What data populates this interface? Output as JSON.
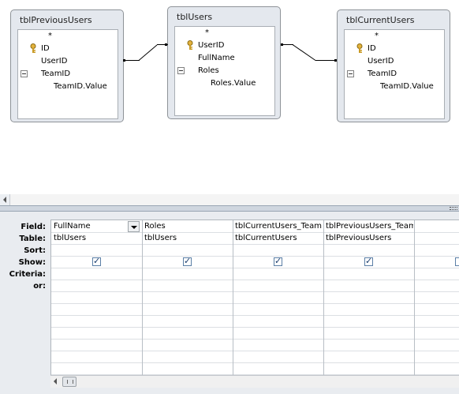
{
  "tables": [
    {
      "id": "prev",
      "title": "tblPreviousUsers",
      "rows": [
        {
          "text": "*",
          "kind": "star"
        },
        {
          "text": "ID",
          "kind": "key"
        },
        {
          "text": "UserID",
          "kind": "field"
        },
        {
          "text": "TeamID",
          "kind": "expand"
        },
        {
          "text": "TeamID.Value",
          "kind": "child"
        }
      ]
    },
    {
      "id": "users",
      "title": "tblUsers",
      "rows": [
        {
          "text": "*",
          "kind": "star"
        },
        {
          "text": "UserID",
          "kind": "key"
        },
        {
          "text": "FullName",
          "kind": "field"
        },
        {
          "text": "Roles",
          "kind": "expand"
        },
        {
          "text": "Roles.Value",
          "kind": "child"
        }
      ]
    },
    {
      "id": "curr",
      "title": "tblCurrentUsers",
      "rows": [
        {
          "text": "*",
          "kind": "star"
        },
        {
          "text": "ID",
          "kind": "key"
        },
        {
          "text": "UserID",
          "kind": "field"
        },
        {
          "text": "TeamID",
          "kind": "expand"
        },
        {
          "text": "TeamID.Value",
          "kind": "child"
        }
      ]
    }
  ],
  "grid": {
    "row_labels": [
      "Field:",
      "Table:",
      "Sort:",
      "Show:",
      "Criteria:",
      "or:"
    ],
    "columns": [
      {
        "field": "FullName",
        "table": "tblUsers",
        "sort": "",
        "show": true,
        "has_dropdown": true
      },
      {
        "field": "Roles",
        "table": "tblUsers",
        "sort": "",
        "show": true,
        "has_dropdown": false
      },
      {
        "field": "tblCurrentUsers_TeamID",
        "table": "tblCurrentUsers",
        "sort": "",
        "show": true,
        "has_dropdown": false
      },
      {
        "field": "tblPreviousUsers_TeamID",
        "table": "tblPreviousUsers",
        "sort": "",
        "show": true,
        "has_dropdown": false
      },
      {
        "field": "",
        "table": "",
        "sort": "",
        "show": false,
        "has_dropdown": false
      }
    ]
  },
  "icons": {
    "key": "key-icon",
    "expand": "minus-box-icon",
    "checkbox": "checkbox-icon"
  },
  "colors": {
    "table_frame": "#e4e8ee",
    "grid_background": "#e9ecf0",
    "checkbox_border": "#5b7fa6"
  }
}
